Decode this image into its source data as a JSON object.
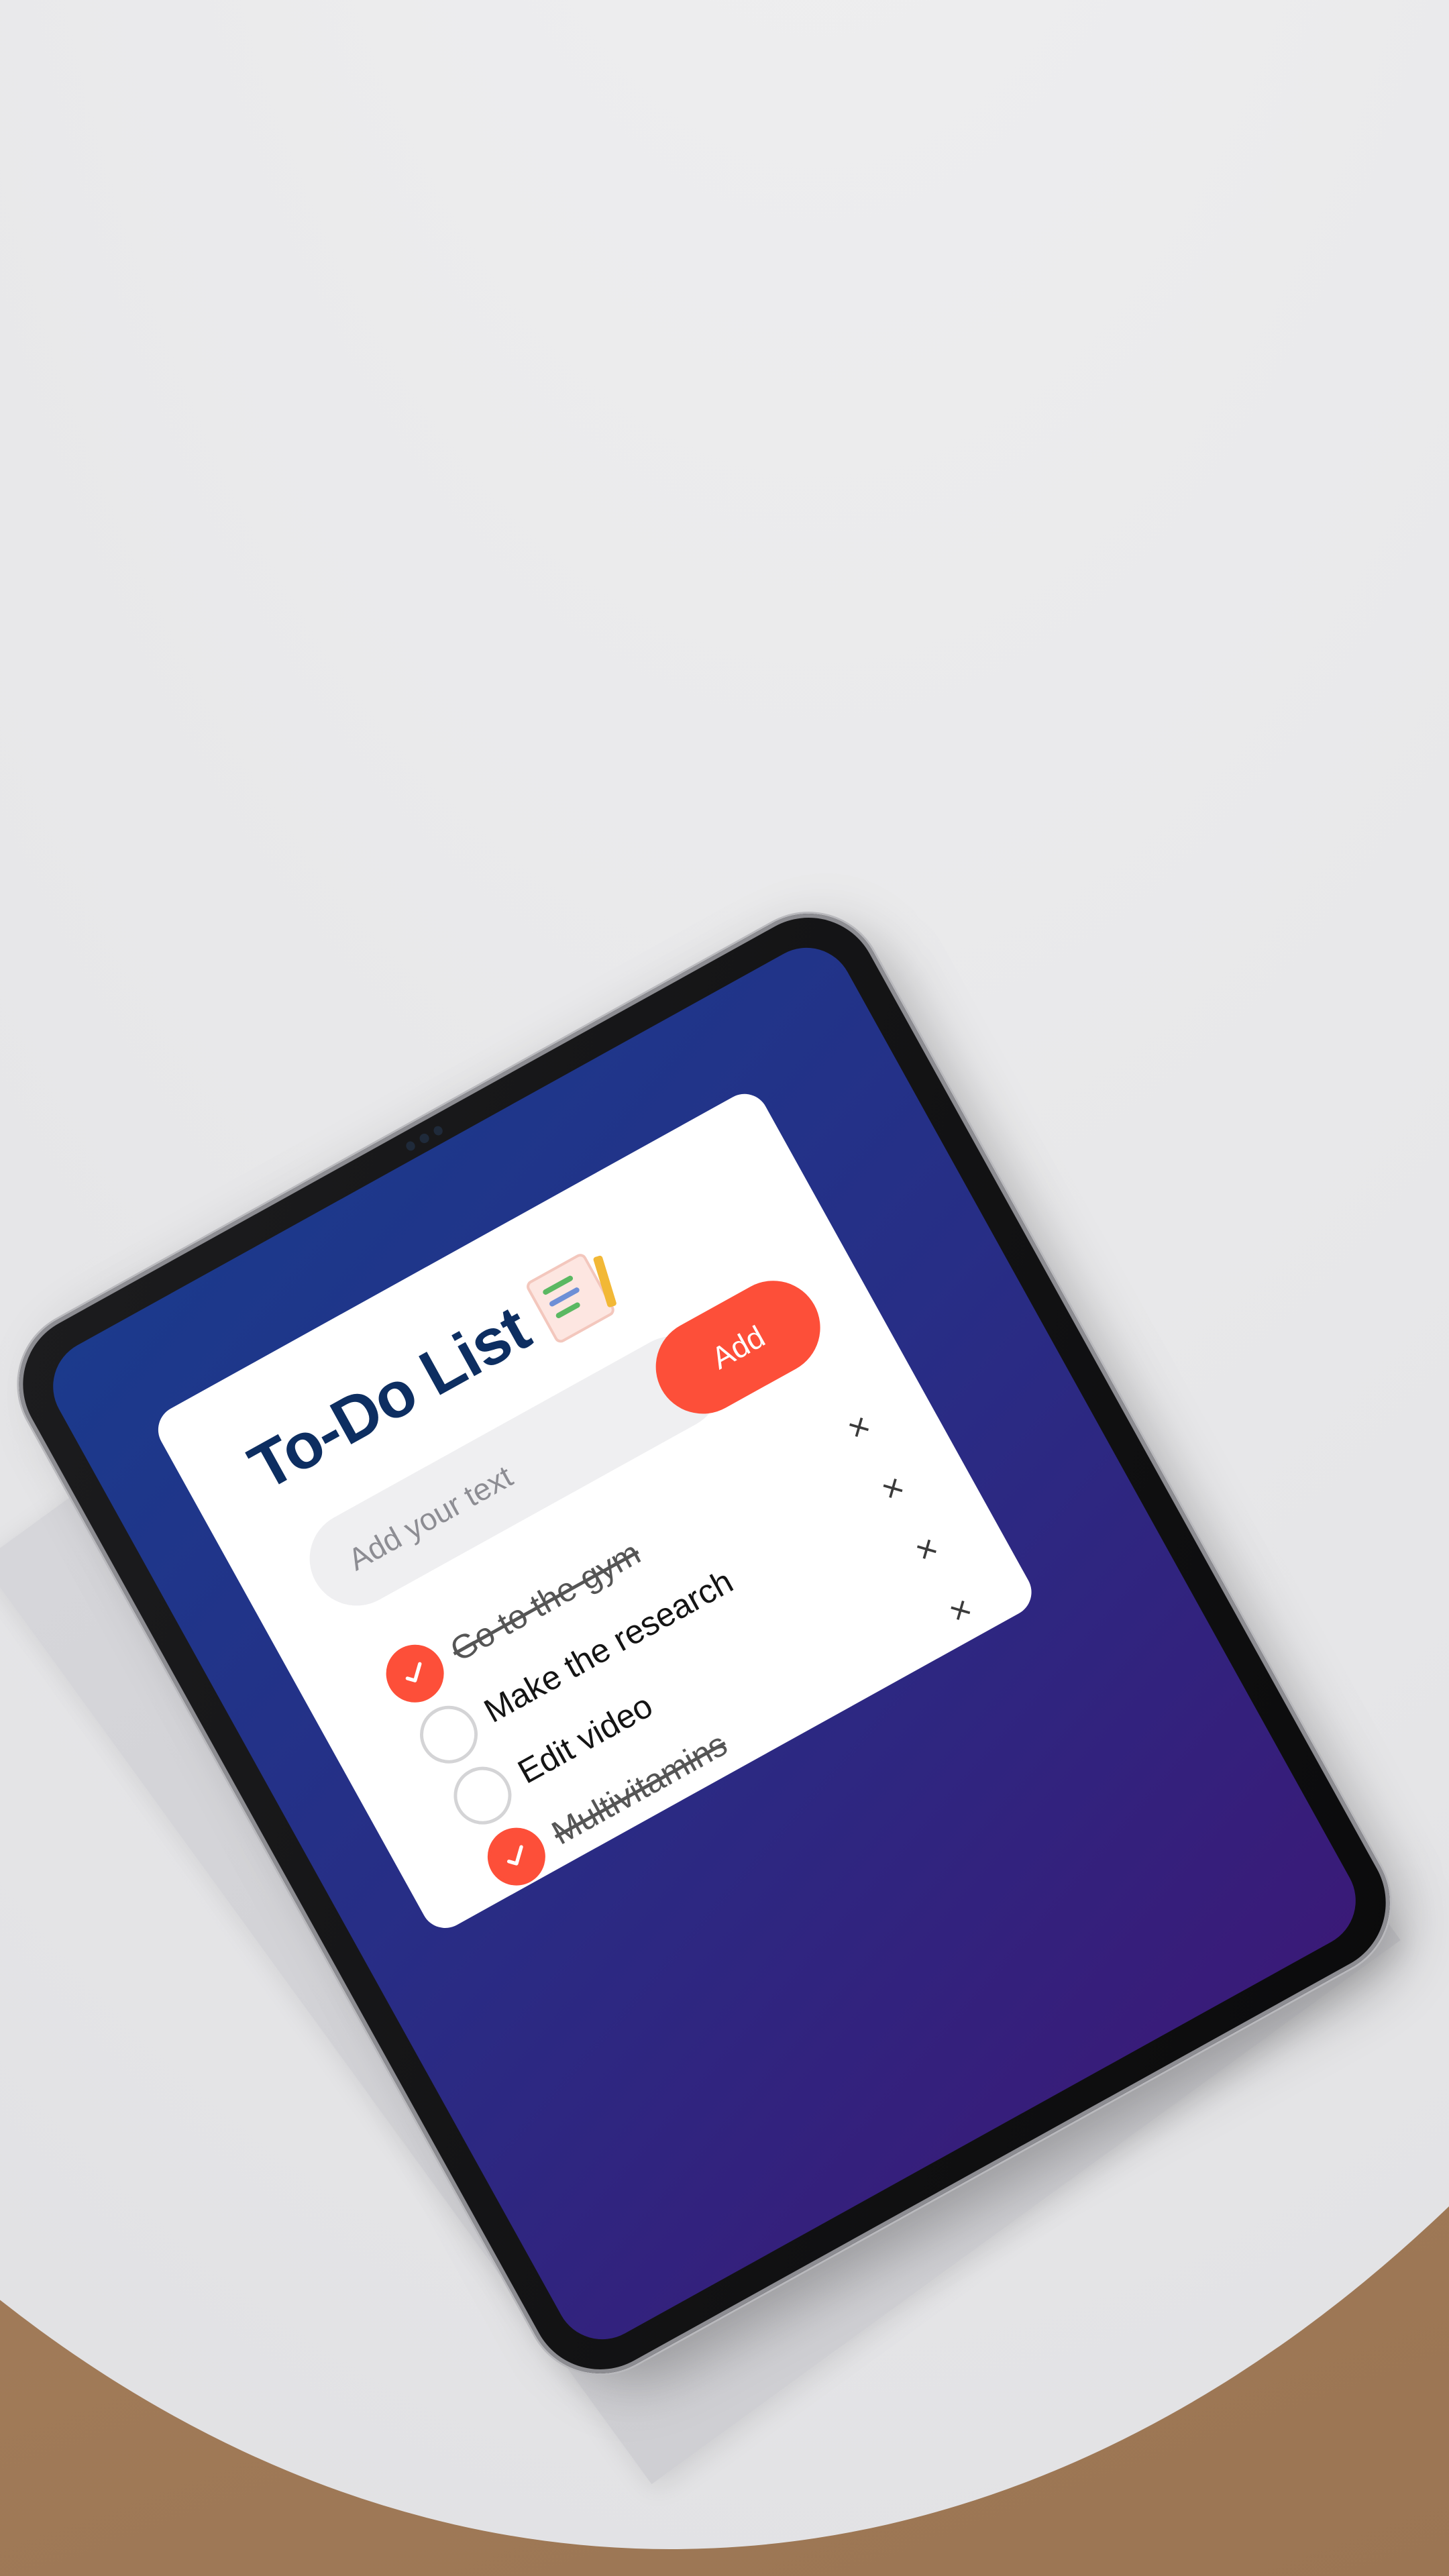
{
  "app": {
    "title": "To-Do List"
  },
  "input": {
    "placeholder": "Add your text",
    "value": ""
  },
  "add_button": {
    "label": "Add"
  },
  "todos": [
    {
      "text": "Go to the gym",
      "done": true,
      "remove_label": "×"
    },
    {
      "text": "Make the research",
      "done": false,
      "remove_label": "×"
    },
    {
      "text": "Edit video",
      "done": false,
      "remove_label": "×"
    },
    {
      "text": "Multivitamins",
      "done": true,
      "remove_label": "×"
    }
  ],
  "colors": {
    "accent": "#fd4f39",
    "title": "#0d2e61",
    "screen_gradient_start": "#1b3a8c",
    "screen_gradient_end": "#3a1a78",
    "card": "#ffffff",
    "input_bg": "#efeff1"
  },
  "icons": {
    "title_icon": "checklist-notepad-icon",
    "check_icon": "checkmark-icon",
    "remove_icon": "close-icon"
  }
}
